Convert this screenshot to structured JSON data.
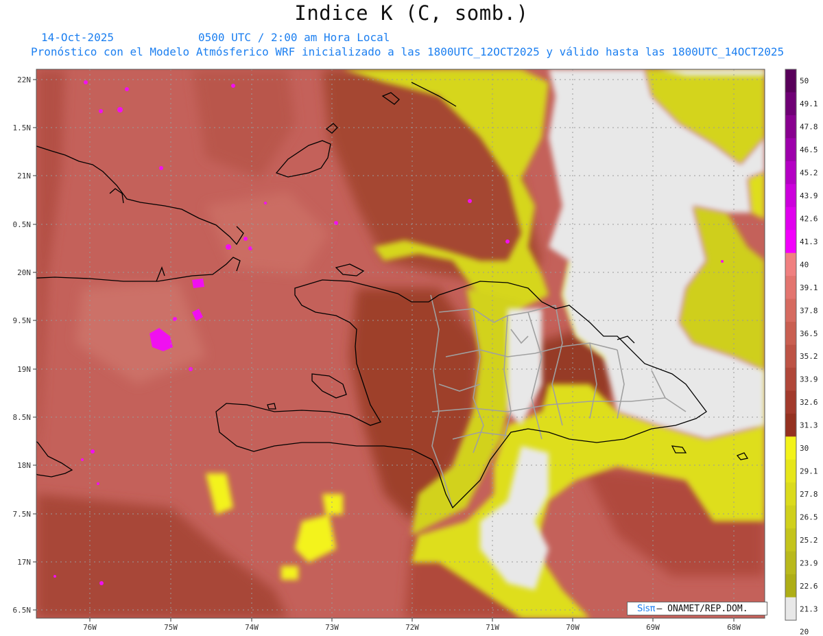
{
  "header": {
    "title": "Indice K (C, somb.)",
    "date": "14-Oct-2025",
    "valid_time": "0500 UTC / 2:00 am Hora Local",
    "model_line": "Pronóstico con el Modelo Atmósferico WRF inicializado a las 1800UTC_12OCT2025 y válido hasta las  1800UTC_14OCT2025"
  },
  "map": {
    "lat_labels": [
      "22N",
      "1.5N",
      "21N",
      "0.5N",
      "20N",
      "9.5N",
      "19N",
      "8.5N",
      "18N",
      "7.5N",
      "17N",
      "6.5N"
    ],
    "lon_labels": [
      "76W",
      "75W",
      "74W",
      "73W",
      "72W",
      "71W",
      "70W",
      "69W",
      "68W"
    ],
    "colors": {
      "no_data": "#e8e8e8",
      "coastline": "#000000",
      "province_borders": "#a0a0a0"
    }
  },
  "colorbar": {
    "labels": [
      "50",
      "49.1",
      "47.8",
      "46.5",
      "45.2",
      "43.9",
      "42.6",
      "41.3",
      "40",
      "39.1",
      "37.8",
      "36.5",
      "35.2",
      "33.9",
      "32.6",
      "31.3",
      "30",
      "29.1",
      "27.8",
      "26.5",
      "25.2",
      "23.9",
      "22.6",
      "21.3",
      "20"
    ],
    "colors": [
      "#58005a",
      "#6f0075",
      "#88008f",
      "#9d00ab",
      "#b400c4",
      "#cc00dc",
      "#e000ee",
      "#f300fc",
      "#f08080",
      "#e3756f",
      "#d66b60",
      "#c95f51",
      "#bd5345",
      "#b04739",
      "#a23a2c",
      "#943120",
      "#f3f31a",
      "#e6e61a",
      "#dbdb1c",
      "#d0d01c",
      "#c4c41c",
      "#b9b91c",
      "#aeae16",
      "#e8e8e8"
    ]
  },
  "credit": {
    "logo": "Sisπ",
    "text": "– ONAMET/REP.DOM."
  }
}
